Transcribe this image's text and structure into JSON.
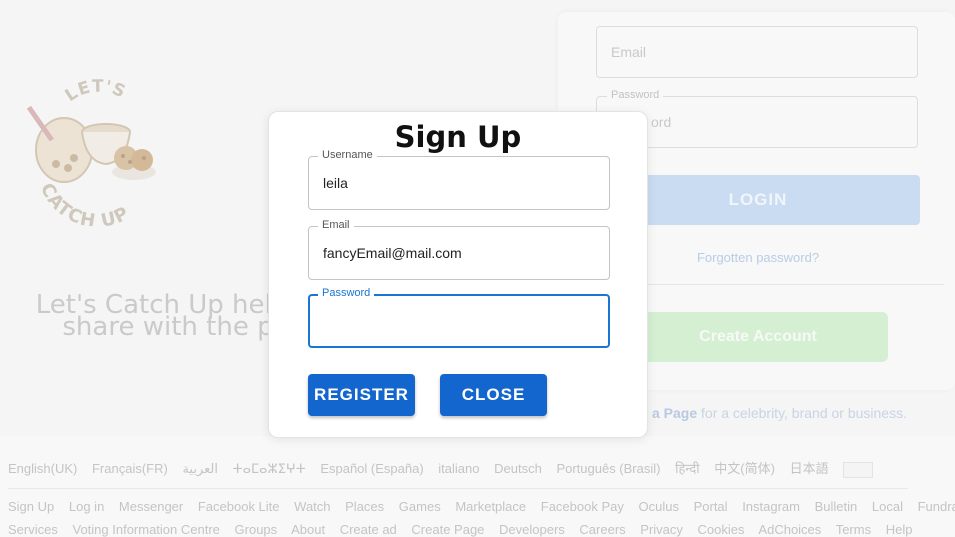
{
  "background": {
    "tagline_line1": "Let's Catch Up help",
    "tagline_line2": "share with the pe",
    "logo_text_top": "LET'S",
    "logo_text_bottom": "CATCH UP",
    "login": {
      "email_placeholder": "Email",
      "password_label": "Password",
      "password_placeholder": "ord",
      "login_label": "LOGIN",
      "forgot_label": "Forgotten password?",
      "create_label": "Create Account"
    },
    "page_note_bold": "a Page",
    "page_note_rest": " for a celebrity, brand or business."
  },
  "footer": {
    "languages": [
      "English(UK)",
      "Français(FR)",
      "العربية",
      "ⵜⴰⵎⴰⵣⵉⵖⵜ",
      "Español (España)",
      "italiano",
      "Deutsch",
      "Português (Brasil)",
      "हिन्दी",
      "中文(简体)",
      "日本語"
    ],
    "links_row1": [
      "Sign Up",
      "Log in",
      "Messenger",
      "Facebook Lite",
      "Watch",
      "Places",
      "Games",
      "Marketplace",
      "Facebook Pay",
      "Oculus",
      "Portal",
      "Instagram",
      "Bulletin",
      "Local",
      "Fundraisers"
    ],
    "links_row2": [
      "Services",
      "Voting Information Centre",
      "Groups",
      "About",
      "Create ad",
      "Create Page",
      "Developers",
      "Careers",
      "Privacy",
      "Cookies",
      "AdChoices",
      "Terms",
      "Help"
    ]
  },
  "modal": {
    "title": "Sign Up",
    "username_label": "Username",
    "username_value": "leila",
    "email_label": "Email",
    "email_value": "fancyEmail@mail.com",
    "password_label": "Password",
    "password_value": "",
    "register_label": "REGISTER",
    "close_label": "CLOSE"
  },
  "colors": {
    "accent": "#1466cf",
    "focus": "#1976d2"
  }
}
